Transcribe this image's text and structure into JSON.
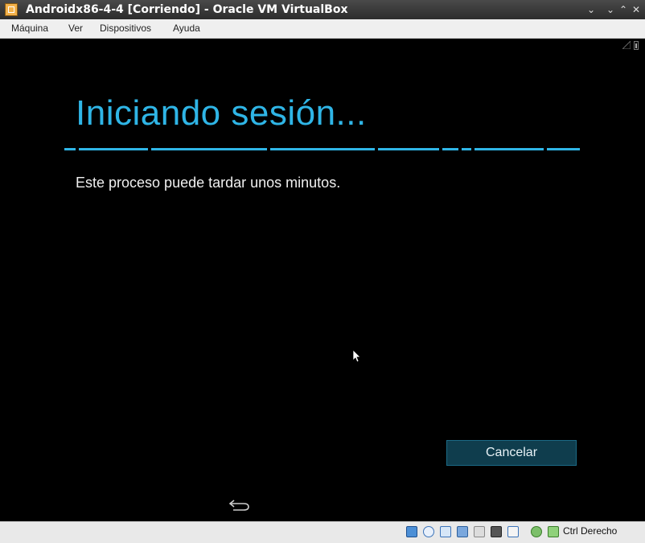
{
  "window": {
    "title": "Androidx86-4-4 [Corriendo] - Oracle VM VirtualBox",
    "controls": {
      "menu": "⌄",
      "minimize": "⌄",
      "maximize": "⌃",
      "close": "✕"
    }
  },
  "menubar": {
    "items": [
      "Máquina",
      "Ver",
      "Dispositivos",
      "Ayuda"
    ]
  },
  "android": {
    "heading": "Iniciando sesión...",
    "message": "Este proceso puede tardar unos minutos.",
    "cancel_label": "Cancelar",
    "accent_color": "#2fb5e6",
    "button_color": "#0f3d4d"
  },
  "statusbar": {
    "icons": [
      "hard-disk-icon",
      "optical-drive-icon",
      "usb-icon",
      "network-icon",
      "shared-folders-icon",
      "display-icon",
      "video-capture-icon",
      "mouse-integration-icon",
      "keyboard-capture-icon"
    ],
    "host_key": "Ctrl Derecho"
  }
}
